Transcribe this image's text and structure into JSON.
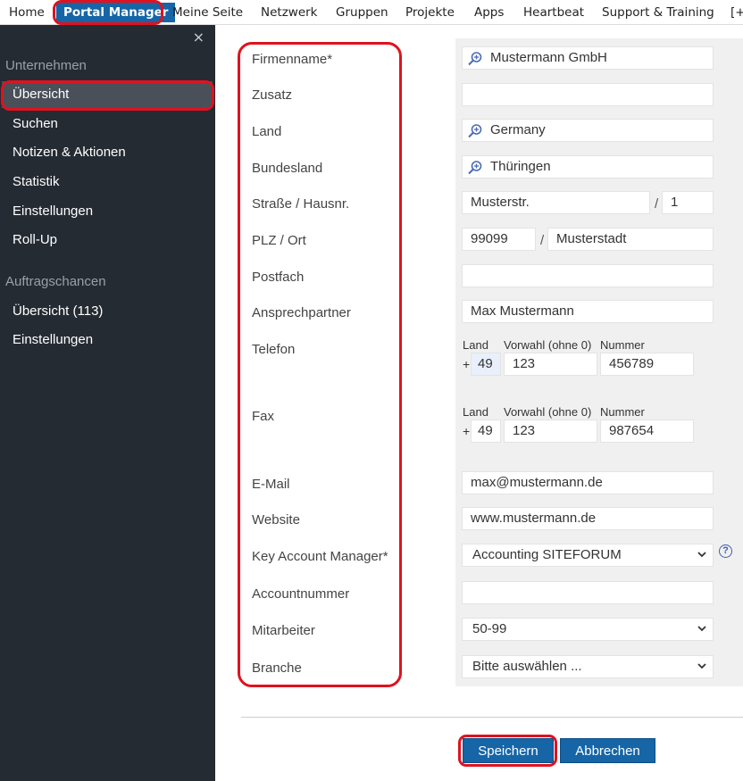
{
  "nav": {
    "items": [
      "Home",
      "Portal Manager",
      "Meine Seite",
      "Netzwerk",
      "Gruppen",
      "Projekte",
      "Apps",
      "Heartbeat",
      "Support & Training",
      "[+"
    ]
  },
  "sidebar": {
    "close": "×",
    "section1": "Unternehmen",
    "items1": [
      "Übersicht",
      "Suchen",
      "Notizen & Aktionen",
      "Statistik",
      "Einstellungen",
      "Roll-Up"
    ],
    "section2": "Auftragschancen",
    "items2": [
      "Übersicht (113)",
      "Einstellungen"
    ]
  },
  "form": {
    "labels": {
      "firmenname": "Firmenname*",
      "zusatz": "Zusatz",
      "land": "Land",
      "bundesland": "Bundesland",
      "strasse": "Straße / Hausnr.",
      "plz": "PLZ / Ort",
      "postfach": "Postfach",
      "ansprechpartner": "Ansprechpartner",
      "telefon": "Telefon",
      "fax": "Fax",
      "email": "E-Mail",
      "website": "Website",
      "kam": "Key Account Manager*",
      "accountnummer": "Accountnummer",
      "mitarbeiter": "Mitarbeiter",
      "branche": "Branche"
    },
    "values": {
      "firmenname": "Mustermann GmbH",
      "zusatz": "",
      "land": "Germany",
      "bundesland": "Thüringen",
      "strasse": "Musterstr.",
      "hausnr": "1",
      "plz": "99099",
      "ort": "Musterstadt",
      "postfach": "",
      "ansprechpartner": "Max Mustermann",
      "email": "max@mustermann.de",
      "website": "www.mustermann.de",
      "kam": "Accounting SITEFORUM",
      "accountnummer": "",
      "mitarbeiter": "50-99",
      "branche": "Bitte auswählen ..."
    },
    "phone_headers": {
      "land": "Land",
      "vorwahl": "Vorwahl (ohne 0)",
      "nummer": "Nummer"
    },
    "plus": "+",
    "slash": "/",
    "telefon": {
      "land": "49",
      "vorwahl": "123",
      "nummer": "456789"
    },
    "fax": {
      "land": "49",
      "vorwahl": "123",
      "nummer": "987654"
    },
    "help": "?"
  },
  "buttons": {
    "save": "Speichern",
    "cancel": "Abbrechen"
  },
  "colors": {
    "accent": "#1565a7",
    "highlight": "#e0121f",
    "sidebar": "#252b33"
  }
}
